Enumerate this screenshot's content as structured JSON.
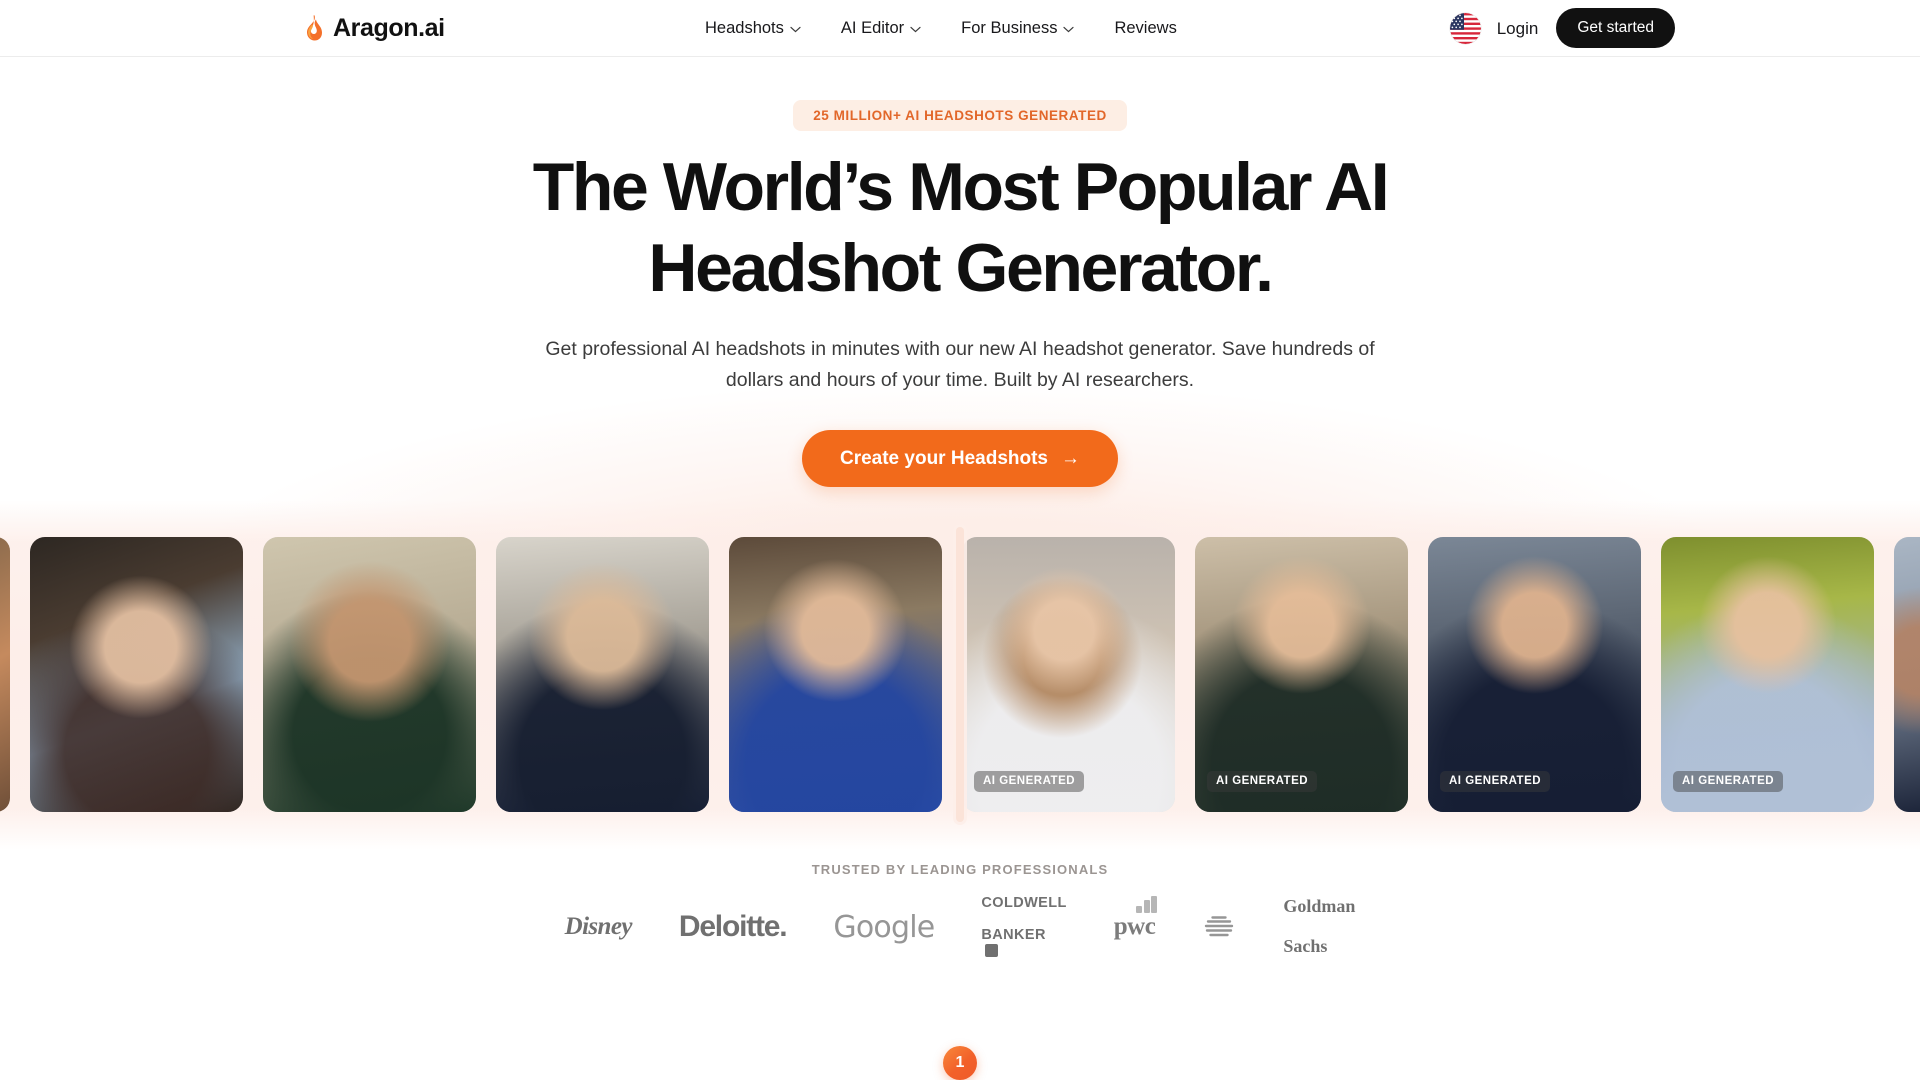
{
  "brand": {
    "name": "Aragon",
    "suffix": ".ai",
    "icon": "flame-icon"
  },
  "nav": {
    "items": [
      {
        "label": "Headshots",
        "has_dropdown": true
      },
      {
        "label": "AI Editor",
        "has_dropdown": true
      },
      {
        "label": "For Business",
        "has_dropdown": true
      },
      {
        "label": "Reviews",
        "has_dropdown": false
      }
    ],
    "locale_icon": "us-flag-icon",
    "login_label": "Login",
    "get_started_label": "Get started"
  },
  "hero": {
    "badge": "25 MILLION+ AI HEADSHOTS GENERATED",
    "title_line1": "The World’s Most Popular AI",
    "title_line2": "Headshot Generator.",
    "subtitle": "Get professional AI headshots in minutes with our new AI headshot generator. Save hundreds of dollars and hours of your time. Built by AI researchers.",
    "cta_label": "Create your Headshots",
    "cta_arrow": "→",
    "accent_color": "#f26a1b",
    "badge_bg": "#fdeee4",
    "badge_color": "#e2672a"
  },
  "carousel": {
    "ai_tag_label": "AI GENERATED",
    "cards": [
      {
        "type": "source",
        "alt": "person-holding-phone-partial",
        "tagged": false
      },
      {
        "type": "source",
        "alt": "woman-dark-hair-in-car",
        "tagged": false
      },
      {
        "type": "source",
        "alt": "man-with-beard-green-shirt",
        "tagged": false
      },
      {
        "type": "source",
        "alt": "woman-with-glasses-navy-top",
        "tagged": false
      },
      {
        "type": "source",
        "alt": "man-blue-shirt-living-room",
        "tagged": false
      },
      {
        "type": "generated",
        "alt": "woman-curly-hair-white-blazer",
        "tagged": true
      },
      {
        "type": "generated",
        "alt": "man-dark-suit-smiling",
        "tagged": true
      },
      {
        "type": "generated",
        "alt": "woman-navy-blazer-city",
        "tagged": true
      },
      {
        "type": "generated",
        "alt": "man-light-blue-shirt-outdoors",
        "tagged": true
      },
      {
        "type": "generated",
        "alt": "woman-dark-blazer-partial",
        "tagged": false
      }
    ]
  },
  "trusted": {
    "label": "TRUSTED BY LEADING PROFESSIONALS",
    "logos": [
      {
        "name": "disney-logo",
        "text": "Disney"
      },
      {
        "name": "deloitte-logo",
        "text": "Deloitte."
      },
      {
        "name": "google-logo",
        "text": "Google"
      },
      {
        "name": "coldwell-banker-logo",
        "line1": "COLDWELL",
        "line2": "BANKER",
        "mark": "▣"
      },
      {
        "name": "pwc-logo",
        "text": "pwc"
      },
      {
        "name": "att-logo",
        "text": ""
      },
      {
        "name": "goldman-sachs-logo",
        "line1": "Goldman",
        "line2": "Sachs"
      }
    ]
  },
  "pager": {
    "current": "1"
  }
}
